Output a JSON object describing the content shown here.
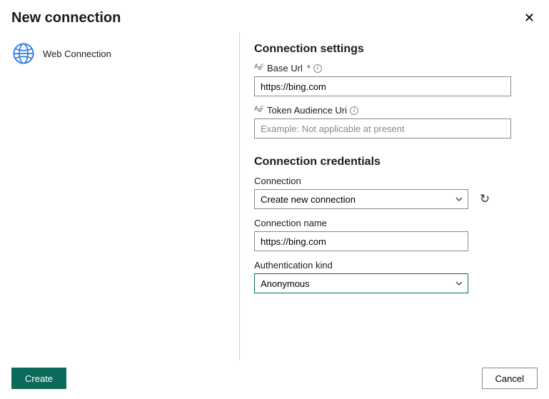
{
  "title": "New connection",
  "left": {
    "item_label": "Web Connection"
  },
  "settings": {
    "heading": "Connection settings",
    "base_url_label": "Base Url",
    "base_url_value": "https://bing.com",
    "token_label": "Token Audience Uri",
    "token_placeholder": "Example: Not applicable at present"
  },
  "credentials": {
    "heading": "Connection credentials",
    "connection_label": "Connection",
    "connection_value": "Create new connection",
    "name_label": "Connection name",
    "name_value": "https://bing.com",
    "auth_label": "Authentication kind",
    "auth_value": "Anonymous"
  },
  "footer": {
    "create": "Create",
    "cancel": "Cancel"
  }
}
